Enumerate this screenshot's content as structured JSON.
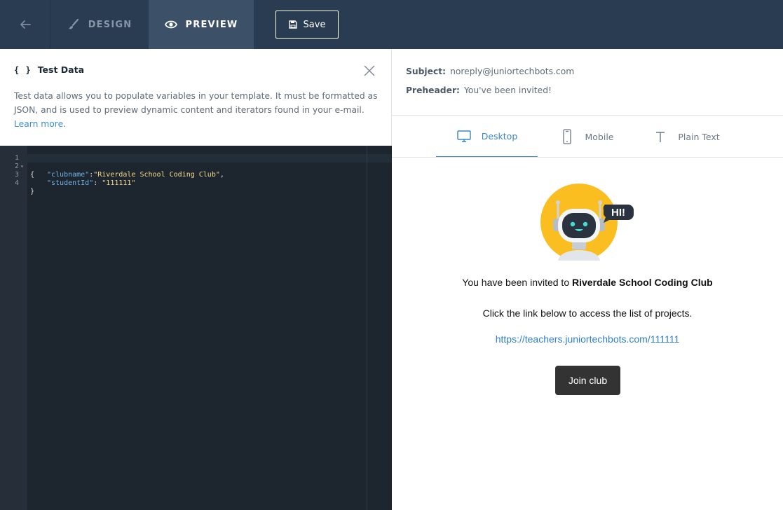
{
  "topbar": {
    "back_icon": "arrow-left-icon",
    "tabs": [
      {
        "label": "DESIGN",
        "icon": "brush-icon",
        "active": false
      },
      {
        "label": "PREVIEW",
        "icon": "eye-icon",
        "active": true
      }
    ],
    "save_label": "Save",
    "colors": {
      "background": "#2a3c51",
      "active_tab": "#3c5168"
    }
  },
  "test_data": {
    "icon": "{ }",
    "title": "Test Data",
    "description": "Test data allows you to populate variables in your template. It must be formatted as JSON, and is used to preview dynamic content and iterators found in your e-mail.",
    "learn_more": "Learn more",
    "editor": {
      "line_numbers": [
        "1",
        "2",
        "3",
        "4"
      ],
      "open_brace": "{",
      "close_brace": "}",
      "key1": "\"clubname\"",
      "value1": "\"Riverdale School Coding Club\"",
      "key2": "\"studentId\"",
      "value2": "\"111111\""
    }
  },
  "preview": {
    "subject_label": "Subject:",
    "subject_value": "noreply@juniortechbots.com",
    "preheader_label": "Preheader:",
    "preheader_value": "You've been invited!",
    "view_tabs": [
      {
        "label": "Desktop",
        "icon": "monitor-icon",
        "active": true
      },
      {
        "label": "Mobile",
        "icon": "phone-icon",
        "active": false
      },
      {
        "label": "Plain Text",
        "icon": "text-icon",
        "active": false
      }
    ],
    "email": {
      "speech_bubble": "HI!",
      "invite_prefix": "You have been invited to",
      "club_name": "Riverdale School Coding Club",
      "instruction": "Click the link below to access the list of projects.",
      "link": "https://teachers.juniortechbots.com/111111",
      "button_label": "Join club"
    },
    "colors": {
      "accent": "#3a85c8",
      "button": "#333333",
      "robot_circle": "#fbbe21"
    }
  }
}
